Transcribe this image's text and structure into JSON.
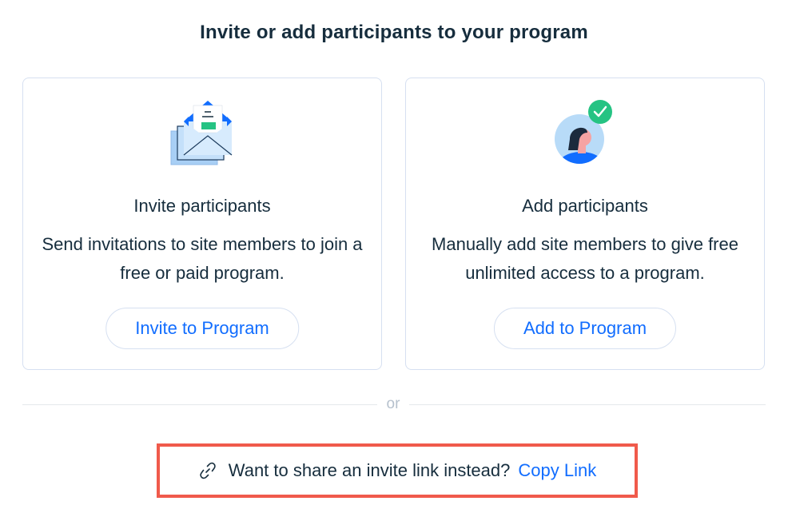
{
  "page": {
    "title": "Invite or add participants to your program"
  },
  "cards": {
    "invite": {
      "title": "Invite participants",
      "description": "Send invitations to site members to join a free or paid program.",
      "button_label": "Invite to Program",
      "icon": "envelope-invitations-icon"
    },
    "add": {
      "title": "Add participants",
      "description": "Manually add site members to give free unlimited access to a program.",
      "button_label": "Add to Program",
      "icon": "person-checkmark-icon"
    }
  },
  "separator": {
    "text": "or"
  },
  "share": {
    "prompt": "Want to share an invite link instead?",
    "link_label": "Copy Link",
    "icon": "link-icon"
  },
  "colors": {
    "accent": "#116dff",
    "text": "#162d3d",
    "border": "#d6e0f1",
    "highlight": "#f05a4b",
    "success": "#25c383"
  }
}
